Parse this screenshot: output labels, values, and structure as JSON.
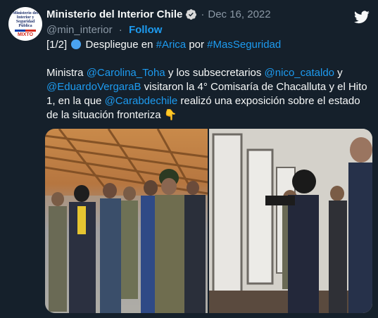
{
  "account": {
    "name": "Ministerio del Interior Chile",
    "handle": "@min_interior",
    "date": "Dec 16, 2022",
    "follow_label": "Follow",
    "separator": "·",
    "avatar_text": "Ministerio del Interior y Seguridad Pública",
    "avatar_badge": "MIXTO"
  },
  "tweet": {
    "line1": {
      "prefix": "[1/2]",
      "text_a": "Despliegue en",
      "tag1": "#Arica",
      "text_b": "por",
      "tag2": "#MasSeguridad"
    },
    "p2": {
      "t1": "Ministra ",
      "m1": "@Carolina_Toha",
      "t2": " y los subsecretarios ",
      "m2": "@nico_cataldo",
      "t3": " y ",
      "m3": "@EduardoVergaraB",
      "t4": " visitaron la 4° Comisaría de Chacalluta y el Hito 1, en la que ",
      "m4": "@Carabdechile",
      "t5": " realizó una exposición sobre el estado de la situación fronteriza"
    },
    "emoji_hand": "👇"
  },
  "icons": {
    "verified": "verified-badge-icon",
    "twitter": "twitter-bird-icon",
    "blue_circle": "blue-circle-emoji"
  },
  "colors": {
    "background": "#15202b",
    "link": "#1d9bf0",
    "muted": "#8b98a5",
    "text": "#f7f9f9"
  }
}
